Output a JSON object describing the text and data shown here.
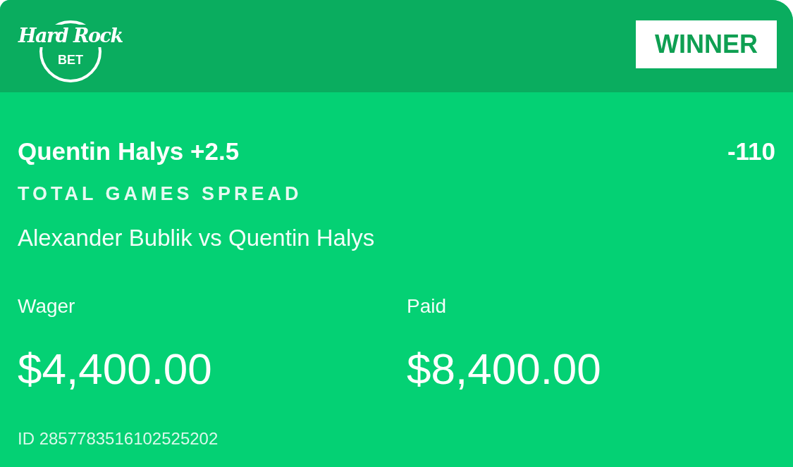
{
  "header": {
    "logo": {
      "wordmark": "Hard Rock",
      "subtext": "BET"
    },
    "status_badge": "WINNER"
  },
  "bet": {
    "selection": "Quentin Halys +2.5",
    "odds": "-110",
    "market": "TOTAL GAMES SPREAD",
    "event": "Alexander Bublik vs Quentin Halys"
  },
  "amounts": [
    {
      "label": "Wager",
      "value": "$4,400.00"
    },
    {
      "label": "Paid",
      "value": "$8,400.00"
    }
  ],
  "bet_id": "ID 2857783516102525202"
}
